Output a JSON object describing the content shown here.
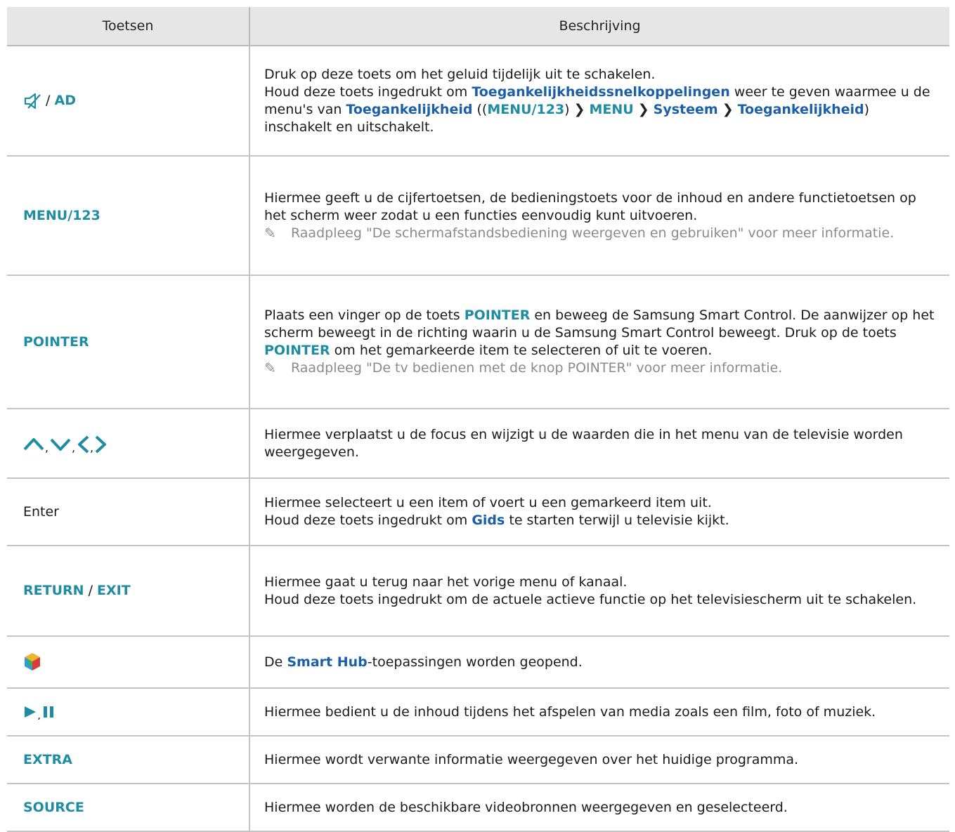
{
  "header": {
    "col1": "Toetsen",
    "col2": "Beschrijving"
  },
  "rows": [
    {
      "key_ad": "AD",
      "p1": "Druk op deze toets om het geluid tijdelijk uit te schakelen.",
      "p2a": "Houd deze toets ingedrukt om ",
      "p2b": "Toegankelijkheidssnelkoppelingen",
      "p2c": " weer te geven waarmee u de menu's van ",
      "p2d": "Toegankelijkheid",
      "p2e": " ((",
      "p2f": "MENU/123",
      "p2g": ")",
      "p2h": "MENU",
      "p2i": "Systeem",
      "p2j": "Toegankelijkheid",
      "p2k": ") inschakelt en uitschakelt."
    },
    {
      "key": "MENU/123",
      "p1": "Hiermee geeft u de cijfertoetsen, de bedieningstoets voor de inhoud en andere functietoetsen op het scherm weer zodat u een functies eenvoudig kunt uitvoeren.",
      "note": "Raadpleeg \"De schermafstandsbediening weergeven en gebruiken\" voor meer informatie."
    },
    {
      "key": "POINTER",
      "p1a": "Plaats een vinger op de toets ",
      "p1b": "POINTER",
      "p1c": " en beweeg de Samsung Smart Control. De aanwijzer op het scherm beweegt in de richting waarin u de Samsung Smart Control beweegt. Druk op de toets ",
      "p1d": "POINTER",
      "p1e": " om het gemarkeerde item te selecteren of uit te voeren.",
      "note": "Raadpleeg \"De tv bedienen met de knop POINTER\" voor meer informatie."
    },
    {
      "p1": "Hiermee verplaatst u de focus en wijzigt u de waarden die in het menu van de televisie worden weergegeven."
    },
    {
      "key": "Enter",
      "p1": "Hiermee selecteert u een item of voert u een gemarkeerd item uit.",
      "p2a": "Houd deze toets ingedrukt om ",
      "p2b": "Gids",
      "p2c": " te starten terwijl u televisie kijkt."
    },
    {
      "key_a": "RETURN",
      "key_sep": " / ",
      "key_b": "EXIT",
      "p1": "Hiermee gaat u terug naar het vorige menu of kanaal.",
      "p2": "Houd deze toets ingedrukt om de actuele actieve functie op het televisiescherm uit te schakelen."
    },
    {
      "p1a": "De ",
      "p1b": "Smart Hub",
      "p1c": "-toepassingen worden geopend."
    },
    {
      "p1": "Hiermee bedient u de inhoud tijdens het afspelen van media zoals een film, foto of muziek."
    },
    {
      "key": "EXTRA",
      "p1": "Hiermee wordt verwante informatie weergegeven over het huidige programma."
    },
    {
      "key": "SOURCE",
      "p1": "Hiermee worden de beschikbare videobronnen weergegeven en geselecteerd."
    }
  ],
  "icons": {
    "mute": "mute-icon",
    "arrows": [
      "up-arrow-icon",
      "down-arrow-icon",
      "left-arrow-icon",
      "right-arrow-icon"
    ],
    "smarthub": "smart-hub-icon",
    "play": "play-icon",
    "pause": "pause-icon",
    "note": "pencil-icon",
    "chevron": "chevron-right-icon"
  },
  "colors": {
    "accent": "#1e8ca3",
    "accent_dark": "#1a5fa8",
    "header_bg": "#e6e6e6",
    "note_text": "#8a8a8a"
  }
}
